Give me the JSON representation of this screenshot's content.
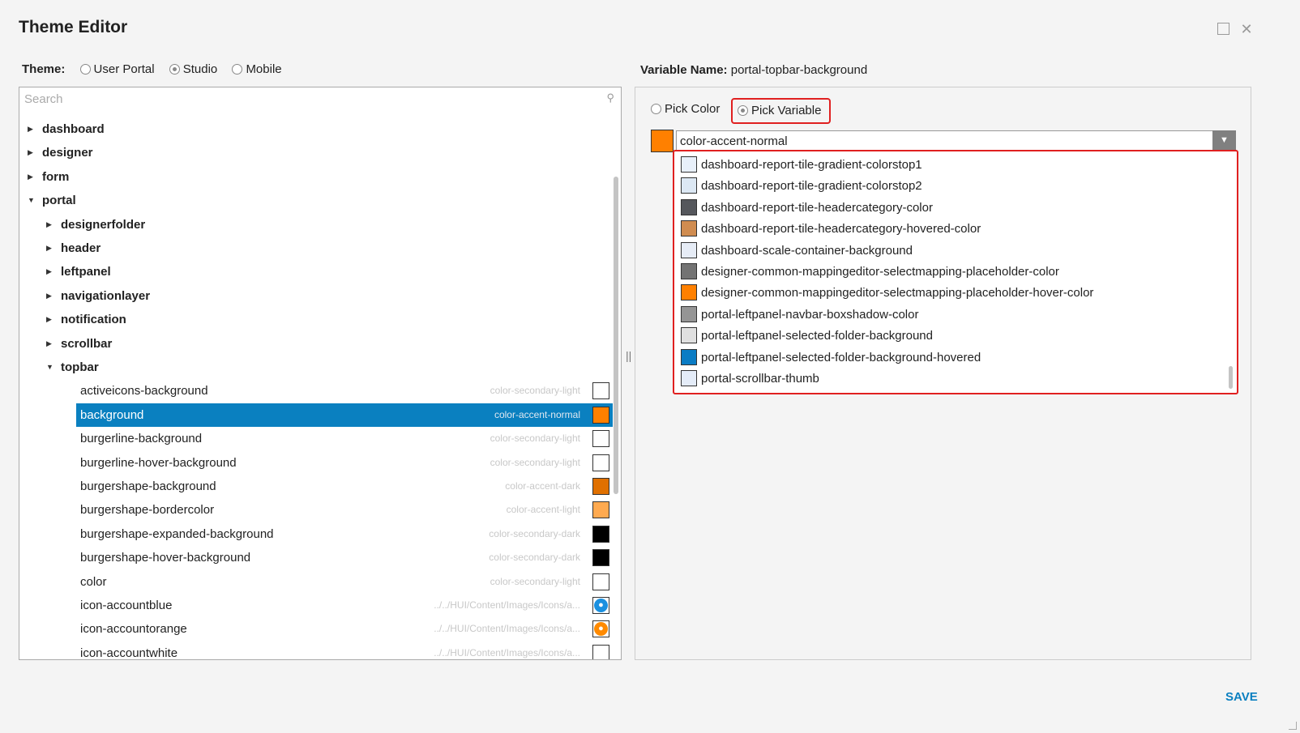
{
  "window": {
    "title": "Theme Editor",
    "maximize_icon": "square-icon",
    "close_icon": "close-icon"
  },
  "theme": {
    "label": "Theme:",
    "options": [
      {
        "label": "User Portal",
        "selected": false
      },
      {
        "label": "Studio",
        "selected": true
      },
      {
        "label": "Mobile",
        "selected": false
      }
    ]
  },
  "search": {
    "placeholder": "Search"
  },
  "tree": [
    {
      "label": "dashboard",
      "level": 1,
      "expanded": false
    },
    {
      "label": "designer",
      "level": 1,
      "expanded": false
    },
    {
      "label": "form",
      "level": 1,
      "expanded": false
    },
    {
      "label": "portal",
      "level": 1,
      "expanded": true
    },
    {
      "label": "designerfolder",
      "level": 2,
      "expanded": false
    },
    {
      "label": "header",
      "level": 2,
      "expanded": false
    },
    {
      "label": "leftpanel",
      "level": 2,
      "expanded": false
    },
    {
      "label": "navigationlayer",
      "level": 2,
      "expanded": false
    },
    {
      "label": "notification",
      "level": 2,
      "expanded": false
    },
    {
      "label": "scrollbar",
      "level": 2,
      "expanded": false
    },
    {
      "label": "topbar",
      "level": 2,
      "expanded": true
    },
    {
      "label": "activeicons-background",
      "level": 3,
      "value": "color-secondary-light",
      "color": "#ffffff"
    },
    {
      "label": "background",
      "level": 3,
      "value": "color-accent-normal",
      "color": "#ff8000",
      "selected": true
    },
    {
      "label": "burgerline-background",
      "level": 3,
      "value": "color-secondary-light",
      "color": "#ffffff"
    },
    {
      "label": "burgerline-hover-background",
      "level": 3,
      "value": "color-secondary-light",
      "color": "#ffffff"
    },
    {
      "label": "burgershape-background",
      "level": 3,
      "value": "color-accent-dark",
      "color": "#e07000"
    },
    {
      "label": "burgershape-bordercolor",
      "level": 3,
      "value": "color-accent-light",
      "color": "#ffaa50"
    },
    {
      "label": "burgershape-expanded-background",
      "level": 3,
      "value": "color-secondary-dark",
      "color": "#000000"
    },
    {
      "label": "burgershape-hover-background",
      "level": 3,
      "value": "color-secondary-dark",
      "color": "#000000"
    },
    {
      "label": "color",
      "level": 3,
      "value": "color-secondary-light",
      "color": "#ffffff"
    },
    {
      "label": "icon-accountblue",
      "level": 3,
      "value": "../../HUI/Content/Images/Icons/a...",
      "icon": "account-icon",
      "color": "#1a90e0"
    },
    {
      "label": "icon-accountorange",
      "level": 3,
      "value": "../../HUI/Content/Images/Icons/a...",
      "icon": "account-icon",
      "color": "#ff8a00"
    },
    {
      "label": "icon-accountwhite",
      "level": 3,
      "value": "../../HUI/Content/Images/Icons/a...",
      "icon": "account-icon",
      "color": "#ffffff"
    }
  ],
  "editor": {
    "variable_label": "Variable Name:",
    "variable_name": "portal-topbar-background",
    "pick_color": "Pick Color",
    "pick_variable": "Pick Variable",
    "mode": "Pick Variable",
    "current_color": "#ff8000",
    "selected_value": "color-accent-normal",
    "options": [
      {
        "label": "dashboard-report-tile-gradient-colorstop1",
        "color": "#e8f0fa"
      },
      {
        "label": "dashboard-report-tile-gradient-colorstop2",
        "color": "#dce8f4"
      },
      {
        "label": "dashboard-report-tile-headercategory-color",
        "color": "#55575c"
      },
      {
        "label": "dashboard-report-tile-headercategory-hovered-color",
        "color": "#d08c50"
      },
      {
        "label": "dashboard-scale-container-background",
        "color": "#e6ecf6"
      },
      {
        "label": "designer-common-mappingeditor-selectmapping-placeholder-color",
        "color": "#737373"
      },
      {
        "label": "designer-common-mappingeditor-selectmapping-placeholder-hover-color",
        "color": "#ff8000"
      },
      {
        "label": "portal-leftpanel-navbar-boxshadow-color",
        "color": "#959595"
      },
      {
        "label": "portal-leftpanel-selected-folder-background",
        "color": "#e0e0e0"
      },
      {
        "label": "portal-leftpanel-selected-folder-background-hovered",
        "color": "#0a7cc4"
      },
      {
        "label": "portal-scrollbar-thumb",
        "color": "#e4ecf8"
      }
    ]
  },
  "save_label": "SAVE"
}
